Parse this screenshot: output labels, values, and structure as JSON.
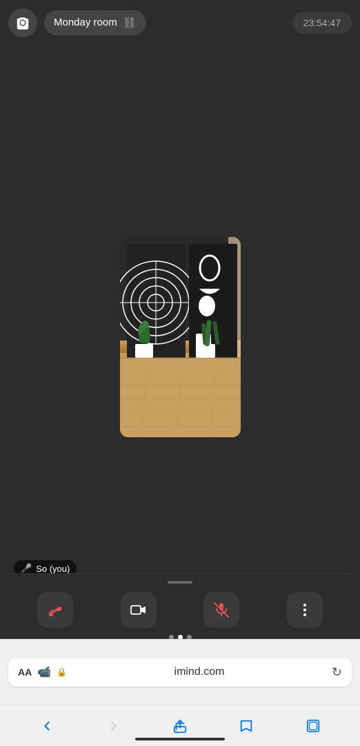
{
  "header": {
    "camera_label": "camera",
    "room_name": "Monday room",
    "link_char": "⛓",
    "timestamp": "23:54:47"
  },
  "user": {
    "label": "So (you)",
    "muted": true
  },
  "controls": {
    "leave_label": "leave",
    "camera_label": "camera-toggle",
    "mic_label": "mic-toggle",
    "more_label": "more"
  },
  "browser": {
    "aa_label": "AA",
    "lock_icon": "🔒",
    "url": "imind.com",
    "refresh_icon": "↻"
  },
  "nav": {
    "back_label": "back",
    "forward_label": "forward",
    "share_label": "share",
    "bookmarks_label": "bookmarks",
    "tabs_label": "tabs"
  },
  "colors": {
    "bg": "#2c2c2c",
    "pill_bg": "#444444",
    "ctrl_bg": "#3a3a3a",
    "red": "#e05050",
    "blue": "#007aff"
  }
}
